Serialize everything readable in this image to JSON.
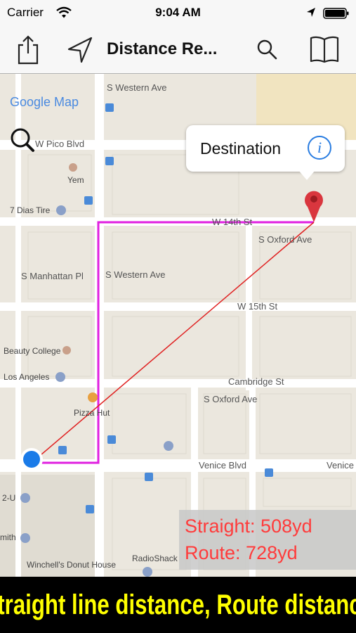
{
  "status": {
    "carrier": "Carrier",
    "time": "9:04 AM"
  },
  "navbar": {
    "title": "Distance Re...",
    "icons": [
      "share-icon",
      "location-arrow-icon",
      "search-icon",
      "book-icon"
    ]
  },
  "map": {
    "provider_label": "Google Map",
    "streets": {
      "pico": "W Pico Blvd",
      "western1": "S Western Ave",
      "western2": "S Western Ave",
      "w14": "W 14th St",
      "w15": "W 15th St",
      "oxford1": "S Oxford Ave",
      "oxford2": "S Oxford Ave",
      "manhattan": "S Manhattan Pl",
      "cambridge": "Cambridge St",
      "venice": "Venice Blvd",
      "venice2": "Venice"
    },
    "places": {
      "yem": "Yem",
      "dias": "7 Dias Tire",
      "beauty": "Beauty College",
      "losangeles": "Los Angeles",
      "pizza": "Pizza Hut",
      "twou": "2-U",
      "smith": "mith",
      "winchell": "Winchell's Donut House",
      "radioshack": "RadioShack"
    },
    "callout": {
      "title": "Destination"
    },
    "route_color": "#e020e0",
    "straight_color": "#e02020"
  },
  "distances": {
    "straight": "Straight: 508yd",
    "route": "Route: 728yd"
  },
  "banner": {
    "text": "Straight line distance, Route distance"
  }
}
